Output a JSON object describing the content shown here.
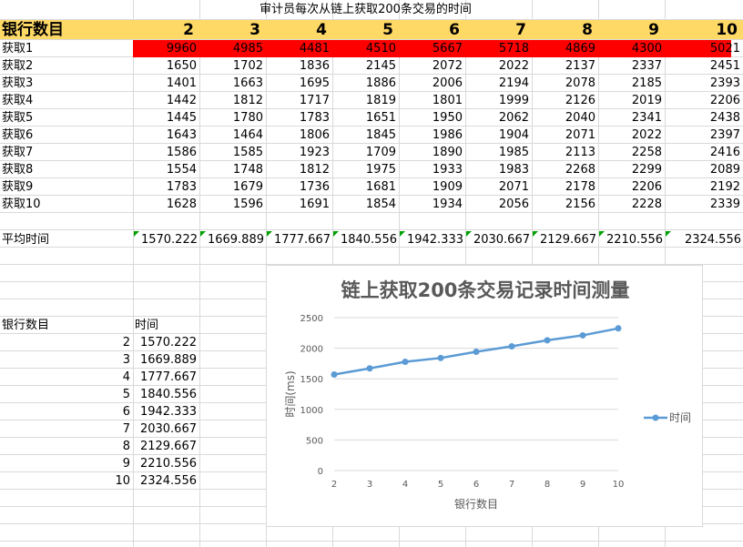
{
  "sheet": {
    "title": "审计员每次从链上获取200条交易的时间",
    "corner_label": "银行数目",
    "columns": [
      "2",
      "3",
      "4",
      "5",
      "6",
      "7",
      "8",
      "9",
      "10"
    ],
    "rows": [
      {
        "label": "获取1",
        "values": [
          "9960",
          "4985",
          "4481",
          "4510",
          "5667",
          "5718",
          "4869",
          "4300",
          "5021"
        ]
      },
      {
        "label": "获取2",
        "values": [
          "1650",
          "1702",
          "1836",
          "2145",
          "2072",
          "2022",
          "2137",
          "2337",
          "2451"
        ]
      },
      {
        "label": "获取3",
        "values": [
          "1401",
          "1663",
          "1695",
          "1886",
          "2006",
          "2194",
          "2078",
          "2185",
          "2393"
        ]
      },
      {
        "label": "获取4",
        "values": [
          "1442",
          "1812",
          "1717",
          "1819",
          "1801",
          "1999",
          "2126",
          "2019",
          "2206"
        ]
      },
      {
        "label": "获取5",
        "values": [
          "1445",
          "1780",
          "1783",
          "1651",
          "1950",
          "2062",
          "2040",
          "2341",
          "2438"
        ]
      },
      {
        "label": "获取6",
        "values": [
          "1643",
          "1464",
          "1806",
          "1845",
          "1986",
          "1904",
          "2071",
          "2022",
          "2397"
        ]
      },
      {
        "label": "获取7",
        "values": [
          "1586",
          "1585",
          "1923",
          "1709",
          "1890",
          "1985",
          "2113",
          "2258",
          "2416"
        ]
      },
      {
        "label": "获取8",
        "values": [
          "1554",
          "1748",
          "1812",
          "1975",
          "1933",
          "1983",
          "2268",
          "2299",
          "2089"
        ]
      },
      {
        "label": "获取9",
        "values": [
          "1783",
          "1679",
          "1736",
          "1681",
          "1909",
          "2071",
          "2178",
          "2206",
          "2192"
        ]
      },
      {
        "label": "获取10",
        "values": [
          "1628",
          "1596",
          "1691",
          "1854",
          "1934",
          "2056",
          "2156",
          "2228",
          "2339"
        ]
      }
    ],
    "avg_label": "平均时间",
    "averages": [
      "1570.222",
      "1669.889",
      "1777.667",
      "1840.556",
      "1942.333",
      "2030.667",
      "2129.667",
      "2210.556",
      "2324.556"
    ],
    "highlight_color": "#ff0000",
    "header_fill": "#ffd966"
  },
  "summary": {
    "header_label": "银行数目",
    "header_value": "时间",
    "rows": [
      {
        "k": "2",
        "v": "1570.222"
      },
      {
        "k": "3",
        "v": "1669.889"
      },
      {
        "k": "4",
        "v": "1777.667"
      },
      {
        "k": "5",
        "v": "1840.556"
      },
      {
        "k": "6",
        "v": "1942.333"
      },
      {
        "k": "7",
        "v": "2030.667"
      },
      {
        "k": "8",
        "v": "2129.667"
      },
      {
        "k": "9",
        "v": "2210.556"
      },
      {
        "k": "10",
        "v": "2324.556"
      }
    ]
  },
  "chart_data": {
    "type": "line",
    "title": "链上获取200条交易记录时间测量",
    "xlabel": "银行数目",
    "ylabel": "时间(ms)",
    "categories": [
      "2",
      "3",
      "4",
      "5",
      "6",
      "7",
      "8",
      "9",
      "10"
    ],
    "series": [
      {
        "name": "时间",
        "values": [
          1570.222,
          1669.889,
          1777.667,
          1840.556,
          1942.333,
          2030.667,
          2129.667,
          2210.556,
          2324.556
        ],
        "color": "#5b9bd5"
      }
    ],
    "ylim": [
      0,
      2500
    ],
    "yticks": [
      "0",
      "500",
      "1000",
      "1500",
      "2000",
      "2500"
    ],
    "grid": true,
    "legend": "right"
  }
}
